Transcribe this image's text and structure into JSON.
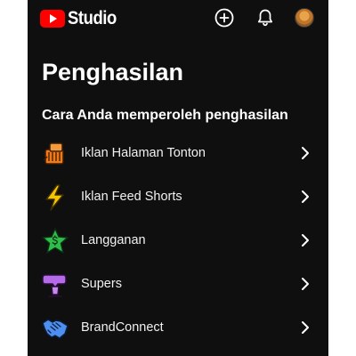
{
  "app": {
    "brand": "Studio",
    "brand_color": "#ff0000",
    "background": "#0f0f0f"
  },
  "header": {
    "icons": [
      "create-icon",
      "notification-bell-icon",
      "avatar"
    ]
  },
  "page": {
    "title": "Penghasilan",
    "section_title": "Cara Anda memperoleh penghasilan"
  },
  "earnings": {
    "items": [
      {
        "label": "Iklan Halaman Tonton",
        "icon": "watch-page-ads-icon",
        "color": "#f07a1a"
      },
      {
        "label": "Iklan Feed Shorts",
        "icon": "lightning-icon",
        "color": "#f5c400"
      },
      {
        "label": "Langganan",
        "icon": "membership-star-icon",
        "color": "#2fbe4a"
      },
      {
        "label": "Supers",
        "icon": "supers-icon",
        "color": "#b56be8"
      },
      {
        "label": "BrandConnect",
        "icon": "handshake-icon",
        "color": "#4f8ff0"
      }
    ]
  }
}
